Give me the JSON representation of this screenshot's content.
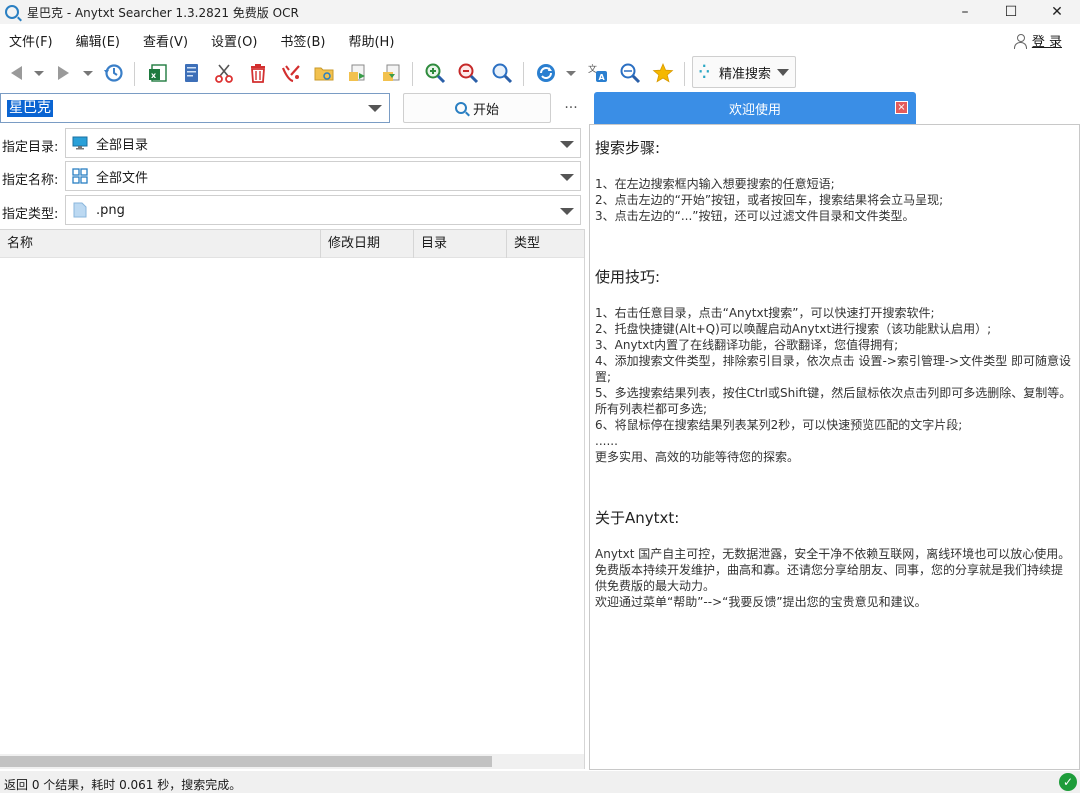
{
  "window": {
    "title": "星巴克 - Anytxt Searcher 1.3.2821 免费版 OCR",
    "minimize": "–",
    "maximize": "☐",
    "close": "✕"
  },
  "menu": {
    "items": [
      "文件(F)",
      "编辑(E)",
      "查看(V)",
      "设置(O)",
      "书签(B)",
      "帮助(H)"
    ],
    "login": "登 录"
  },
  "toolbar": {
    "icons": [
      "back-icon",
      "back-dropdown-icon",
      "forward-icon",
      "forward-dropdown-icon",
      "history-icon",
      "excel-export-icon",
      "document-icon",
      "cut-icon",
      "delete-icon",
      "clean-icon",
      "folder-icon",
      "open-file-icon",
      "copy-file-icon",
      "zoom-in-icon",
      "zoom-out-icon",
      "search-icon",
      "refresh-icon",
      "refresh-dropdown-icon",
      "translate-icon",
      "search-image-icon",
      "star-icon"
    ],
    "search_mode": "精准搜索"
  },
  "search": {
    "query": "星巴克",
    "start_label": "开始",
    "more_label": "..."
  },
  "filters": {
    "directory_label": "指定目录:",
    "directory_value": "全部目录",
    "name_label": "指定名称:",
    "name_value": "全部文件",
    "type_label": "指定类型:",
    "type_value": ".png"
  },
  "results": {
    "columns": [
      "名称",
      "修改日期",
      "目录",
      "类型"
    ],
    "rows": []
  },
  "welcome": {
    "tab_label": "欢迎使用",
    "steps_title": "搜索步骤:",
    "steps": [
      "1、在左边搜索框内输入想要搜索的任意短语;",
      "2、点击左边的“开始”按钮，或者按回车，搜索结果将会立马呈现;",
      "3、点击左边的“...”按钮，还可以过滤文件目录和文件类型。"
    ],
    "tips_title": "使用技巧:",
    "tips": [
      "1、右击任意目录，点击“Anytxt搜索”，可以快速打开搜索软件;",
      "2、托盘快捷键(Alt+Q)可以唤醒启动Anytxt进行搜索（该功能默认启用）;",
      "3、Anytxt内置了在线翻译功能，谷歌翻译，您值得拥有;",
      "4、添加搜索文件类型，排除索引目录，依次点击 设置->索引管理->文件类型 即可随意设置;",
      "5、多选搜索结果列表，按住Ctrl或Shift键，然后鼠标依次点击列即可多选删除、复制等。所有列表栏都可多选;",
      "6、将鼠标停在搜索结果列表某列2秒，可以快速预览匹配的文字片段;",
      "......",
      "更多实用、高效的功能等待您的探索。"
    ],
    "about_title": "关于Anytxt:",
    "about": [
      "Anytxt 国产自主可控，无数据泄露，安全干净不依赖互联网，离线环境也可以放心使用。",
      "免费版本持续开发维护，曲高和寡。还请您分享给朋友、同事，您的分享就是我们持续提供免费版的最大动力。",
      "欢迎通过菜单“帮助”-->“我要反馈”提出您的宝贵意见和建议。"
    ]
  },
  "status": {
    "text": "返回 0 个结果，耗时 0.061 秒，搜索完成。"
  }
}
